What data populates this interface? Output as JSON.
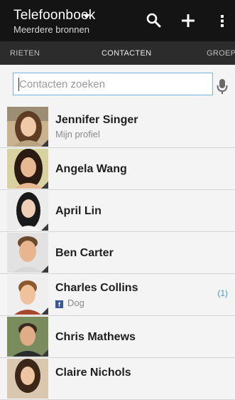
{
  "app_bar": {
    "title": "Telefoonboek",
    "subtitle": "Meerdere bronnen",
    "icons": [
      "search-icon",
      "plus-icon",
      "overflow-menu-icon"
    ]
  },
  "tabs": [
    {
      "label": "RIETEN"
    },
    {
      "label": "CONTACTEN",
      "active": true
    },
    {
      "label": "GROEPEN"
    }
  ],
  "search": {
    "placeholder": "Contacten zoeken",
    "value": ""
  },
  "contacts": [
    {
      "name": "Jennifer Singer",
      "subtitle": "Mijn profiel"
    },
    {
      "name": "Angela Wang"
    },
    {
      "name": "April Lin"
    },
    {
      "name": "Ben Carter"
    },
    {
      "name": "Charles Collins",
      "subtitle": "Dog",
      "subtitle_icon": "facebook-icon",
      "count": "(1)"
    },
    {
      "name": "Chris Mathews"
    },
    {
      "name": "Claire Nichols"
    }
  ],
  "colors": {
    "app_bar_bg": "#141414",
    "tab_bar_bg": "#2c2c2c",
    "list_bg": "#f4f4f4",
    "accent": "#3a9ad9",
    "search_border": "#7ab3d6"
  }
}
